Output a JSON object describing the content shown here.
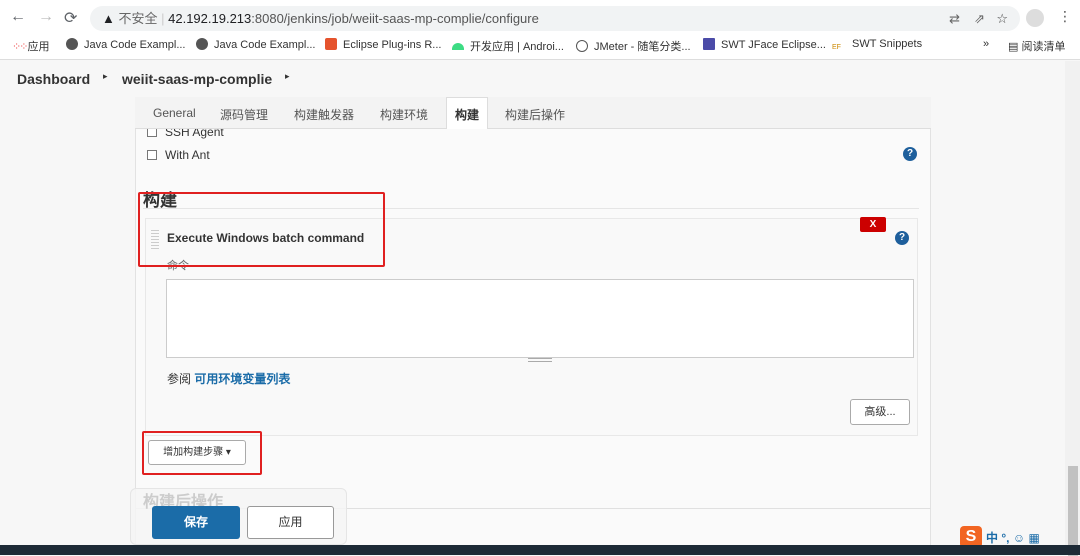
{
  "browser": {
    "back": "←",
    "forward": "→",
    "reload": "⟳",
    "security": "不安全",
    "url_host": "42.192.19.213",
    "url_rest": ":8080/jenkins/job/weiit-saas-mp-complie/configure",
    "bookmarks": [
      "应用",
      "Java Code Exampl...",
      "Java Code Exampl...",
      "Eclipse Plug-ins R...",
      "开发应用 | Androi...",
      "JMeter - 随笔分类...",
      "SWT JFace Eclipse...",
      "SWT Snippets"
    ],
    "more": "»",
    "reading_list": "阅读清单"
  },
  "breadcrumb": {
    "items": [
      "Dashboard",
      "weiit-saas-mp-complie"
    ]
  },
  "tabs": [
    "General",
    "源码管理",
    "构建触发器",
    "构建环境",
    "构建",
    "构建后操作"
  ],
  "active_tab": "构建",
  "env_options": [
    "SSH Agent",
    "With Ant"
  ],
  "build": {
    "section_title": "构建",
    "step_title": "Execute Windows batch command",
    "delete_label": "X",
    "command_label": "命令",
    "command_value": "",
    "see_prefix": "参阅",
    "env_link": "可用环境变量列表",
    "advanced": "高级...",
    "add_step": "增加构建步骤"
  },
  "post_build_title": "构建后操作",
  "actions": {
    "save": "保存",
    "apply": "应用"
  },
  "ime": {
    "lang": "中",
    "punct": "°,"
  },
  "colors": {
    "primary": "#1b6ca8",
    "danger": "#cc0000",
    "highlight": "#e02020"
  }
}
